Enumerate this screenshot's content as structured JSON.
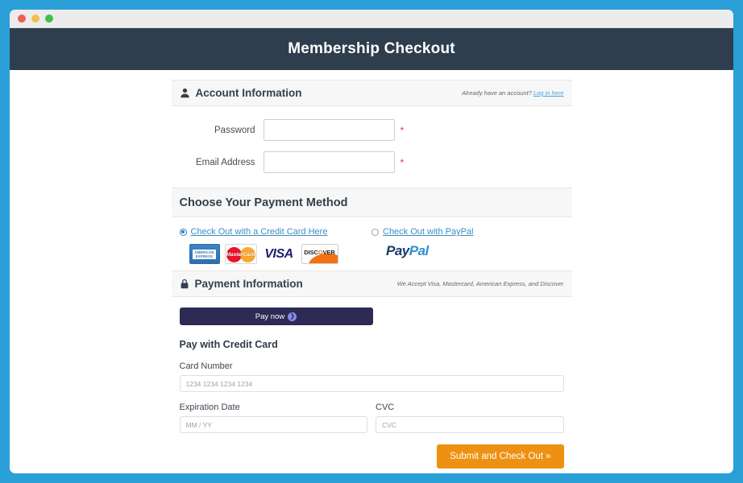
{
  "window": {
    "traffic_lights": [
      "close",
      "minimize",
      "maximize"
    ]
  },
  "header": {
    "title": "Membership Checkout"
  },
  "account_section": {
    "icon": "user-icon",
    "title": "Account Information",
    "note_text": "Already have an account?",
    "note_link": "Log in here",
    "fields": [
      {
        "label": "Password",
        "value": "",
        "placeholder": "",
        "required": "*",
        "type": "password"
      },
      {
        "label": "Email Address",
        "value": "",
        "placeholder": "",
        "required": "*",
        "type": "email"
      }
    ]
  },
  "payment_method_section": {
    "title": "Choose Your Payment Method",
    "options": [
      {
        "label": "Check Out with a Credit Card Here",
        "selected": true
      },
      {
        "label": "Check Out with PayPal",
        "selected": false
      }
    ],
    "card_logos": [
      {
        "name": "american-express",
        "line1": "AMERICAN",
        "line2": "EXPRESS"
      },
      {
        "name": "mastercard",
        "text": "MasterCard"
      },
      {
        "name": "visa",
        "text": "VISA"
      },
      {
        "name": "discover",
        "text_before": "DISC",
        "text_o": "O",
        "text_after": "VER"
      }
    ],
    "paypal_logo": {
      "part1": "Pay",
      "part2": "Pal"
    }
  },
  "payment_information_section": {
    "icon": "lock-icon",
    "title": "Payment Information",
    "note": "We Accept Visa, Mastercard, American Express, and Discover",
    "pay_now_button": "Pay now",
    "pay_now_chevron": "❯",
    "credit_card_title": "Pay with Credit Card",
    "card_number_label": "Card Number",
    "card_number_placeholder": "1234 1234 1234 1234",
    "card_number_value": "",
    "expiration_label": "Expiration Date",
    "expiration_placeholder": "MM / YY",
    "expiration_value": "",
    "cvc_label": "CVC",
    "cvc_placeholder": "CVC",
    "cvc_value": "",
    "submit_button": "Submit and Check Out »"
  },
  "colors": {
    "page_background": "#2b9fd8",
    "header_background": "#2e3e4e",
    "accent_orange": "#ee9112",
    "link_blue": "#3a8fc4",
    "required_red": "#d83b3b",
    "paynow_navy": "#2d2a55"
  }
}
